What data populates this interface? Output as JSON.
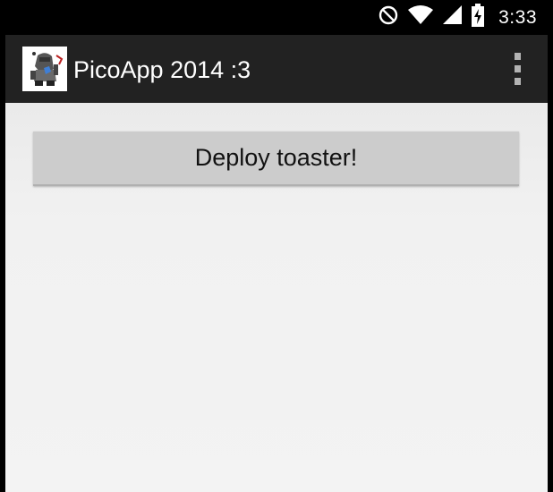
{
  "status_bar": {
    "time": "3:33",
    "icons": [
      "do-not-disturb-icon",
      "wifi-icon",
      "cell-signal-icon",
      "battery-charging-icon"
    ]
  },
  "action_bar": {
    "title": "PicoApp 2014 :3",
    "app_icon": "robot-mascot-icon",
    "menu_icon": "overflow-menu-icon"
  },
  "main": {
    "deploy_button_label": "Deploy toaster!"
  },
  "colors": {
    "status_bar_bg": "#000000",
    "action_bar_bg": "#222222",
    "content_bg": "#f0f0f0",
    "button_bg": "#cccccc"
  }
}
